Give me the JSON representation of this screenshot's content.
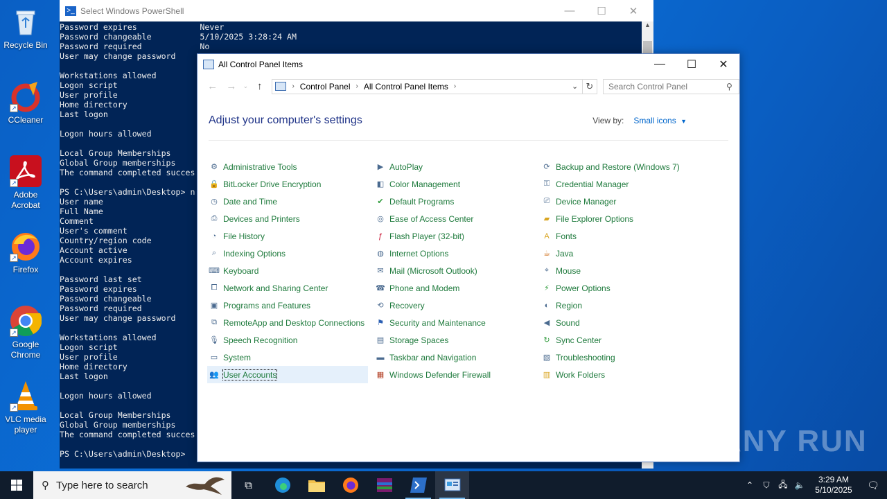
{
  "desktop": {
    "icons": [
      {
        "label": "Recycle Bin"
      },
      {
        "label": "CCleaner"
      },
      {
        "label": "Adobe Acrobat"
      },
      {
        "label": "Firefox"
      },
      {
        "label": "Google Chrome"
      },
      {
        "label": "VLC media player"
      }
    ]
  },
  "powershell": {
    "title": "Select Windows PowerShell",
    "lines": "Password expires             Never\nPassword changeable          5/10/2025 3:28:24 AM\nPassword required            No\nUser may change password\n\nWorkstations allowed\nLogon script\nUser profile\nHome directory\nLast logon\n\nLogon hours allowed\n\nLocal Group Memberships\nGlobal Group memberships\nThe command completed succes\n\nPS C:\\Users\\admin\\Desktop> n\nUser name\nFull Name\nComment\nUser's comment\nCountry/region code\nAccount active\nAccount expires\n\nPassword last set\nPassword expires\nPassword changeable\nPassword required\nUser may change password\n\nWorkstations allowed\nLogon script\nUser profile\nHome directory\nLast logon\n\nLogon hours allowed\n\nLocal Group Memberships\nGlobal Group memberships\nThe command completed succes\n\nPS C:\\Users\\admin\\Desktop>"
  },
  "control_panel": {
    "title": "All Control Panel Items",
    "breadcrumb": [
      "Control Panel",
      "All Control Panel Items"
    ],
    "search_placeholder": "Search Control Panel",
    "heading": "Adjust your computer's settings",
    "view_by_label": "View by:",
    "view_by_value": "Small icons",
    "columns": [
      [
        {
          "label": "Administrative Tools",
          "icon": "admin-tools-icon"
        },
        {
          "label": "BitLocker Drive Encryption",
          "icon": "bitlocker-icon"
        },
        {
          "label": "Date and Time",
          "icon": "clock-icon"
        },
        {
          "label": "Devices and Printers",
          "icon": "printer-icon"
        },
        {
          "label": "File History",
          "icon": "file-history-icon"
        },
        {
          "label": "Indexing Options",
          "icon": "indexing-icon"
        },
        {
          "label": "Keyboard",
          "icon": "keyboard-icon"
        },
        {
          "label": "Network and Sharing Center",
          "icon": "network-icon"
        },
        {
          "label": "Programs and Features",
          "icon": "programs-icon"
        },
        {
          "label": "RemoteApp and Desktop Connections",
          "icon": "remoteapp-icon"
        },
        {
          "label": "Speech Recognition",
          "icon": "microphone-icon"
        },
        {
          "label": "System",
          "icon": "system-icon"
        },
        {
          "label": "User Accounts",
          "icon": "user-accounts-icon"
        }
      ],
      [
        {
          "label": "AutoPlay",
          "icon": "autoplay-icon"
        },
        {
          "label": "Color Management",
          "icon": "color-icon"
        },
        {
          "label": "Default Programs",
          "icon": "default-programs-icon"
        },
        {
          "label": "Ease of Access Center",
          "icon": "ease-access-icon"
        },
        {
          "label": "Flash Player (32-bit)",
          "icon": "flash-icon"
        },
        {
          "label": "Internet Options",
          "icon": "internet-icon"
        },
        {
          "label": "Mail (Microsoft Outlook)",
          "icon": "mail-icon"
        },
        {
          "label": "Phone and Modem",
          "icon": "phone-icon"
        },
        {
          "label": "Recovery",
          "icon": "recovery-icon"
        },
        {
          "label": "Security and Maintenance",
          "icon": "flag-icon"
        },
        {
          "label": "Storage Spaces",
          "icon": "storage-icon"
        },
        {
          "label": "Taskbar and Navigation",
          "icon": "taskbar-icon"
        },
        {
          "label": "Windows Defender Firewall",
          "icon": "firewall-icon"
        }
      ],
      [
        {
          "label": "Backup and Restore (Windows 7)",
          "icon": "backup-icon"
        },
        {
          "label": "Credential Manager",
          "icon": "credential-icon"
        },
        {
          "label": "Device Manager",
          "icon": "device-manager-icon"
        },
        {
          "label": "File Explorer Options",
          "icon": "folder-options-icon"
        },
        {
          "label": "Fonts",
          "icon": "fonts-icon"
        },
        {
          "label": "Java",
          "icon": "java-icon"
        },
        {
          "label": "Mouse",
          "icon": "mouse-icon"
        },
        {
          "label": "Power Options",
          "icon": "power-icon"
        },
        {
          "label": "Region",
          "icon": "globe-icon"
        },
        {
          "label": "Sound",
          "icon": "speaker-icon"
        },
        {
          "label": "Sync Center",
          "icon": "sync-icon"
        },
        {
          "label": "Troubleshooting",
          "icon": "troubleshoot-icon"
        },
        {
          "label": "Work Folders",
          "icon": "work-folders-icon"
        }
      ]
    ],
    "selected_item": "User Accounts"
  },
  "taskbar": {
    "search_placeholder": "Type here to search",
    "time": "3:29 AM",
    "date": "5/10/2025"
  },
  "watermark": "ANY RUN"
}
